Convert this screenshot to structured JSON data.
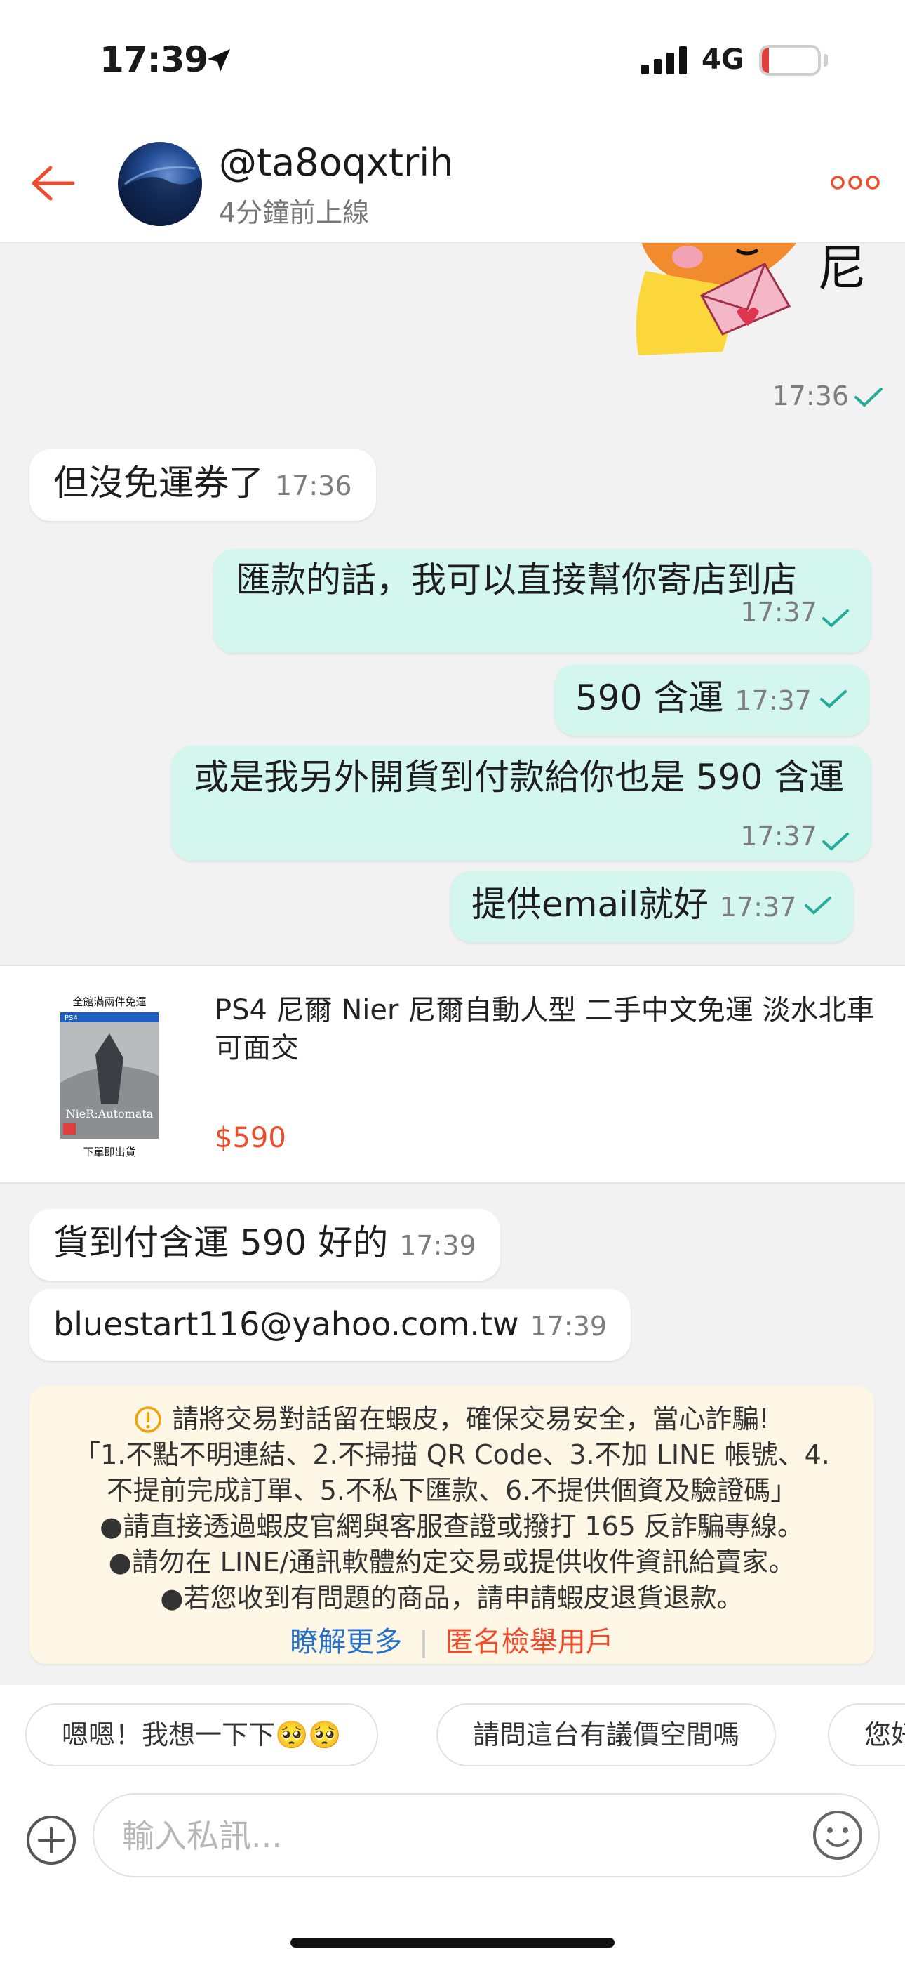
{
  "status_bar": {
    "time": "17:39",
    "network": "4G",
    "battery": "11",
    "battery_level": 0.11
  },
  "header": {
    "username": "@ta8oqxtrih",
    "last_online": "4分鐘前上線"
  },
  "messages": {
    "sticker": {
      "time": "17:36",
      "text": "尼"
    },
    "m1": {
      "text": "但沒免運券了",
      "time": "17:36"
    },
    "m2": {
      "text": "匯款的話，我可以直接幫你寄店到店",
      "time": "17:37"
    },
    "m3": {
      "text": "590 含運",
      "time": "17:37"
    },
    "m4": {
      "text": "或是我另外開貨到付款給你也是 590 含運",
      "time": "17:37"
    },
    "m5": {
      "text": "提供email就好",
      "time": "17:37"
    },
    "m6": {
      "text": "貨到付含運 590 好的",
      "time": "17:39"
    },
    "m7": {
      "text": "bluestart116@yahoo.com.tw",
      "time": "17:39"
    }
  },
  "product": {
    "title": "PS4 尼爾 Nier 尼爾自動人型 二手中文免運 淡水北車可面交",
    "price": "$590",
    "cover_top_text": "全館滿兩件免運",
    "cover_bottom_text": "下單即出貨",
    "cover_logo": "NieR:Automata"
  },
  "warning": {
    "title": "請將交易對話留在蝦皮，確保交易安全，當心詐騙!",
    "line1": "「1.不點不明連結、2.不掃描 QR Code、3.不加 LINE 帳號、4.",
    "line2": "不提前完成訂單、5.不私下匯款、6.不提供個資及驗證碼」",
    "line3": "●請直接透過蝦皮官網與客服查證或撥打 165 反詐騙專線。",
    "line4": "●請勿在 LINE/通訊軟體約定交易或提供收件資訊給賣家。",
    "line5": "●若您收到有問題的商品，請申請蝦皮退貨退款。",
    "learn_more": "瞭解更多",
    "report": "匿名檢舉用戶"
  },
  "quick_replies": [
    {
      "label": "嗯嗯！我想一下下🥺🥺"
    },
    {
      "label": "請問這台有議價空間嗎"
    },
    {
      "label": "您好"
    }
  ],
  "input": {
    "placeholder": "輸入私訊..."
  },
  "colors": {
    "accent": "#ee4d2d",
    "outgoing_bubble": "#d3f6ee",
    "check": "#26aa99",
    "link": "#2672c8",
    "warning_bg": "#fff7e5"
  },
  "icons": [
    "location-arrow-icon",
    "signal-icon",
    "battery-icon",
    "back-arrow-icon",
    "more-icon",
    "read-check-icon",
    "warning-icon",
    "plus-icon",
    "emoji-icon"
  ]
}
